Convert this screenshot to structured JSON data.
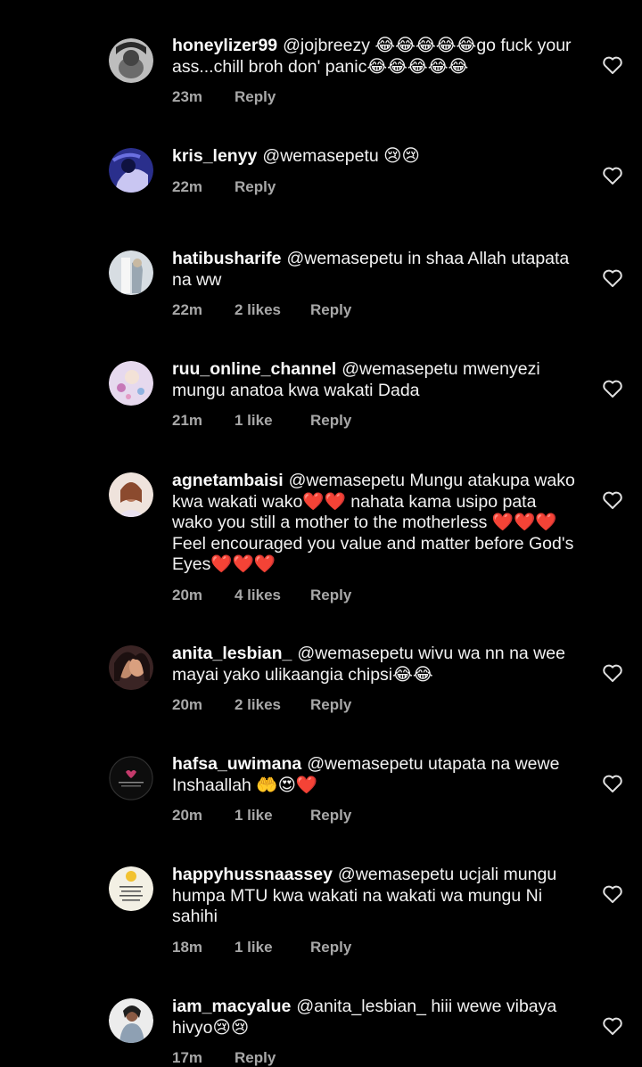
{
  "comments": [
    {
      "username": "honeylizer99",
      "text": "@jojbreezy 😂😂😂😂😂go fuck your ass...chill broh don' panic😂😂😂😂😂",
      "time": "23m",
      "likes": "",
      "reply": "Reply",
      "avatar_color": "#8a8a8a"
    },
    {
      "username": "kris_lenyy",
      "text": "@wemasepetu 😢😢",
      "time": "22m",
      "likes": "",
      "reply": "Reply",
      "avatar_color": "#3b3f9c"
    },
    {
      "username": "hatibusharife",
      "text": "@wemasepetu  in shaa Allah utapata na ww",
      "time": "22m",
      "likes": "2 likes",
      "reply": "Reply",
      "avatar_color": "#c9d2da"
    },
    {
      "username": "ruu_online_channel",
      "text": "@wemasepetu mwenyezi mungu anatoa kwa wakati Dada",
      "time": "21m",
      "likes": "1 like",
      "reply": "Reply",
      "avatar_color": "#d8c8e6"
    },
    {
      "username": "agnetambaisi",
      "text": "@wemasepetu Mungu atakupa wako kwa wakati wako❤️❤️ nahata kama usipo pata wako you still a mother to the motherless ❤️❤️❤️ Feel encouraged you value and matter before God's Eyes❤️❤️❤️",
      "time": "20m",
      "likes": "4 likes",
      "reply": "Reply",
      "avatar_color": "#e8d0c4"
    },
    {
      "username": "anita_lesbian_",
      "text": "@wemasepetu wivu wa nn na wee mayai yako ulikaangia chipsi😂😂",
      "time": "20m",
      "likes": "2 likes",
      "reply": "Reply",
      "avatar_color": "#5a3a3a"
    },
    {
      "username": "hafsa_uwimana",
      "text": "@wemasepetu utapata na wewe Inshaallah 🤲😍❤️",
      "time": "20m",
      "likes": "1 like",
      "reply": "Reply",
      "avatar_color": "#111111"
    },
    {
      "username": "happyhussnaassey",
      "text": "@wemasepetu ucjali mungu humpa MTU kwa wakati na wakati wa mungu Ni sahihi",
      "time": "18m",
      "likes": "1 like",
      "reply": "Reply",
      "avatar_color": "#f1efe6"
    },
    {
      "username": "iam_macyalue",
      "text": "@anita_lesbian_ hiii wewe vibaya hivyo😢😢",
      "time": "17m",
      "likes": "",
      "reply": "Reply",
      "avatar_color": "#d9d9d9"
    }
  ]
}
